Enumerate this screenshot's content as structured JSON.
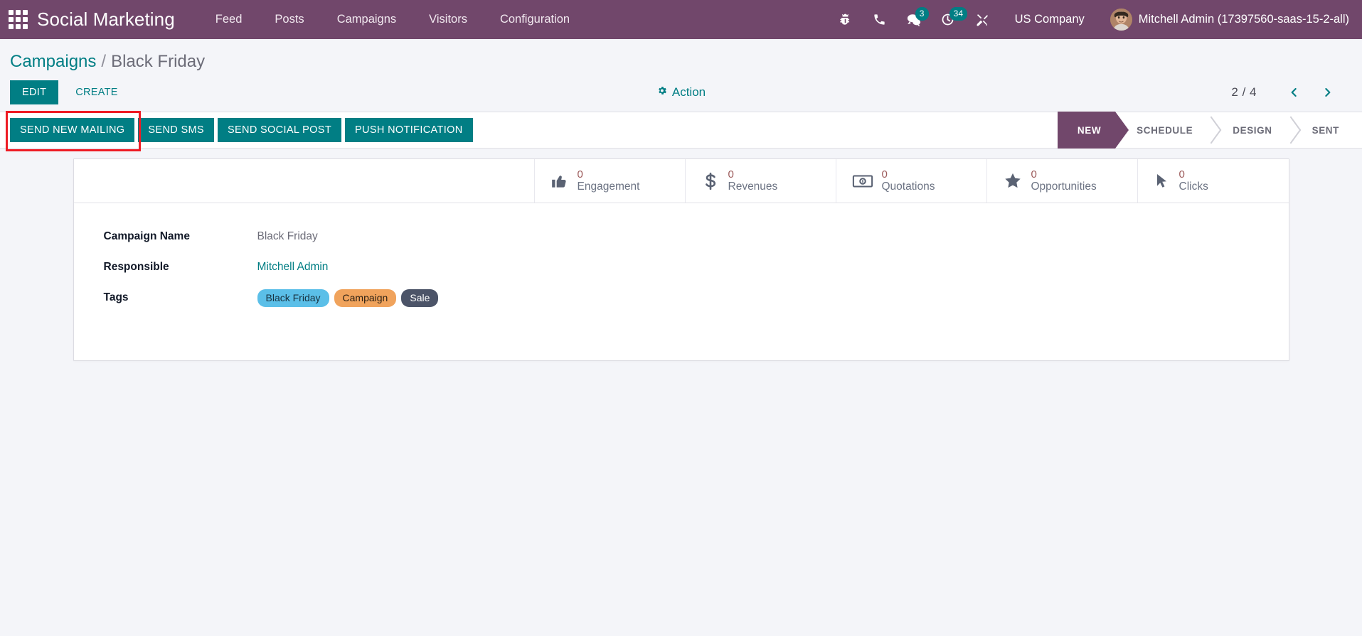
{
  "navbar": {
    "apps_icon": "apps-grid-icon",
    "brand": "Social Marketing",
    "menu": [
      {
        "label": "Feed"
      },
      {
        "label": "Posts"
      },
      {
        "label": "Campaigns"
      },
      {
        "label": "Visitors"
      },
      {
        "label": "Configuration"
      }
    ],
    "icons": [
      {
        "name": "bug-icon",
        "badge": null
      },
      {
        "name": "phone-icon",
        "badge": null
      },
      {
        "name": "messages-icon",
        "badge": "3"
      },
      {
        "name": "activities-clock-icon",
        "badge": "34"
      },
      {
        "name": "tools-icon",
        "badge": null
      }
    ],
    "company": "US Company",
    "user": "Mitchell Admin (17397560-saas-15-2-all)",
    "avatar": "user-avatar"
  },
  "breadcrumb": {
    "parent": "Campaigns",
    "separator": "/",
    "current": "Black Friday"
  },
  "control_panel": {
    "edit_label": "EDIT",
    "create_label": "CREATE",
    "action_label": "Action",
    "action_icon": "gear-icon",
    "pager_text": "2 / 4",
    "prev_icon": "chevron-left-icon",
    "next_icon": "chevron-right-icon"
  },
  "sheet_buttons": [
    {
      "label": "SEND NEW MAILING",
      "highlighted": true
    },
    {
      "label": "SEND SMS",
      "highlighted": false
    },
    {
      "label": "SEND SOCIAL POST",
      "highlighted": false
    },
    {
      "label": "PUSH NOTIFICATION",
      "highlighted": false
    }
  ],
  "statusbar": {
    "steps": [
      {
        "label": "NEW",
        "active": true
      },
      {
        "label": "SCHEDULE",
        "active": false
      },
      {
        "label": "DESIGN",
        "active": false
      },
      {
        "label": "SENT",
        "active": false
      }
    ]
  },
  "stat_buttons": [
    {
      "value": "0",
      "label": "Engagement",
      "icon": "thumbs-up-icon"
    },
    {
      "value": "0",
      "label": "Revenues",
      "icon": "dollar-sign-icon"
    },
    {
      "value": "0",
      "label": "Quotations",
      "icon": "money-bill-icon"
    },
    {
      "value": "0",
      "label": "Opportunities",
      "icon": "star-icon"
    },
    {
      "value": "0",
      "label": "Clicks",
      "icon": "mouse-pointer-icon"
    }
  ],
  "form": {
    "campaign_name_label": "Campaign Name",
    "campaign_name_value": "Black Friday",
    "responsible_label": "Responsible",
    "responsible_value": "Mitchell Admin",
    "tags_label": "Tags",
    "tags": [
      {
        "label": "Black Friday",
        "bg": "#5bbfe8",
        "fg": "#17313f"
      },
      {
        "label": "Campaign",
        "bg": "#f0a35c",
        "fg": "#2d2113"
      },
      {
        "label": "Sale",
        "bg": "#4c5468",
        "fg": "#ffffff"
      }
    ]
  },
  "colors": {
    "brand_purple": "#71476b",
    "accent_teal": "#017e84",
    "badge_teal": "#017e84",
    "page_bg": "#f4f5f9",
    "highlight_red": "#ee1b24",
    "stat_value": "#9c5a5a"
  }
}
